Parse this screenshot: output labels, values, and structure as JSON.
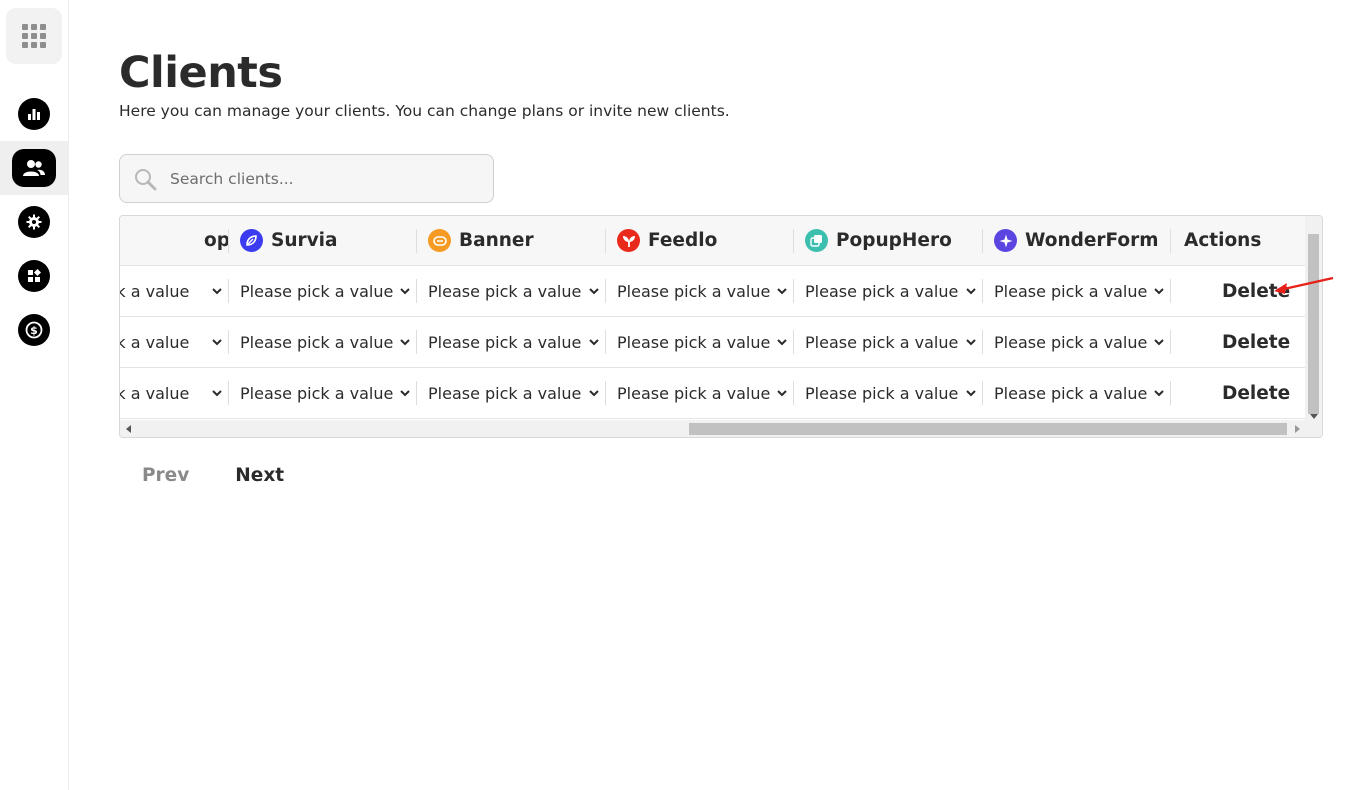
{
  "page": {
    "title": "Clients",
    "subtitle": "Here you can manage your clients. You can change plans or invite new clients."
  },
  "sidebar": {
    "apps_icon": "apps-grid-icon",
    "items": [
      {
        "icon": "bar-chart-icon",
        "active": false
      },
      {
        "icon": "users-icon",
        "active": true
      },
      {
        "icon": "gear-icon",
        "active": false
      },
      {
        "icon": "widgets-icon",
        "active": false
      },
      {
        "icon": "dollar-icon",
        "active": false
      }
    ]
  },
  "search": {
    "placeholder": "Search clients..."
  },
  "table": {
    "columns": [
      {
        "label": "op",
        "icon": null,
        "color": null
      },
      {
        "label": "Survia",
        "icon": "leaf-icon",
        "color": "#3b3bf0"
      },
      {
        "label": "Banner",
        "icon": "pill-icon",
        "color": "#f59a22"
      },
      {
        "label": "Feedlo",
        "icon": "sprout-icon",
        "color": "#e8291c"
      },
      {
        "label": "PopupHero",
        "icon": "layers-icon",
        "color": "#3cbfae"
      },
      {
        "label": "WonderForm",
        "icon": "sparkle-icon",
        "color": "#5b45e0"
      },
      {
        "label": "Actions",
        "icon": null,
        "color": null
      }
    ],
    "rows": [
      {
        "cells": [
          "Please pick a value",
          "Please pick a value",
          "Please pick a value",
          "Please pick a value",
          "Please pick a value",
          "Please pick a value"
        ],
        "action": "Delete"
      },
      {
        "cells": [
          "Please pick a value",
          "Please pick a value",
          "Please pick a value",
          "Please pick a value",
          "Please pick a value",
          "Please pick a value"
        ],
        "action": "Delete"
      },
      {
        "cells": [
          "Please pick a value",
          "Please pick a value",
          "Please pick a value",
          "Please pick a value",
          "Please pick a value",
          "Please pick a value"
        ],
        "action": "Delete"
      }
    ]
  },
  "pagination": {
    "prev": "Prev",
    "next": "Next"
  },
  "colors": {
    "annotation_arrow": "#e8201a",
    "nav_icon_bg": "#000000"
  }
}
